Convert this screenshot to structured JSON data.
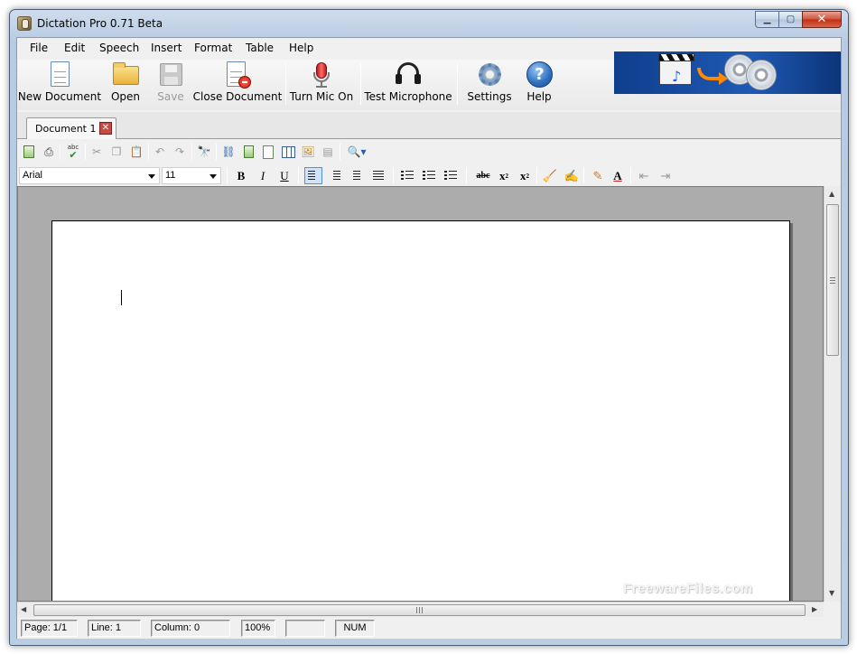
{
  "window": {
    "title": "Dictation Pro 0.71 Beta"
  },
  "menu": [
    "File",
    "Edit",
    "Speech",
    "Insert",
    "Format",
    "Table",
    "Help"
  ],
  "toolbar": {
    "new_document": "New Document",
    "open": "Open",
    "save": "Save",
    "close_document": "Close Document",
    "turn_mic_on": "Turn Mic On",
    "test_microphone": "Test Microphone",
    "settings": "Settings",
    "help": "Help"
  },
  "tabs": [
    {
      "label": "Document 1",
      "close_glyph": "✕"
    }
  ],
  "format": {
    "font_name": "Arial",
    "font_size": "11",
    "bold": "B",
    "italic": "I",
    "underline": "U",
    "strikethrough": "abc",
    "subscript": "x",
    "subscript_mark": "2",
    "superscript": "x",
    "superscript_mark": "2",
    "spellcheck": "abc",
    "font_color_letter": "A"
  },
  "document": {
    "watermark": "FreewareFiles.com"
  },
  "statusbar": {
    "page": "Page: 1/1",
    "line": "Line: 1",
    "column": "Column: 0",
    "zoom": "100%",
    "blank": "",
    "num": "NUM"
  },
  "colors": {
    "titlebar": "#b9cde3",
    "banner": "#1f5ab4",
    "doc_background": "#acacac",
    "active_align": "#cfe3fb"
  }
}
